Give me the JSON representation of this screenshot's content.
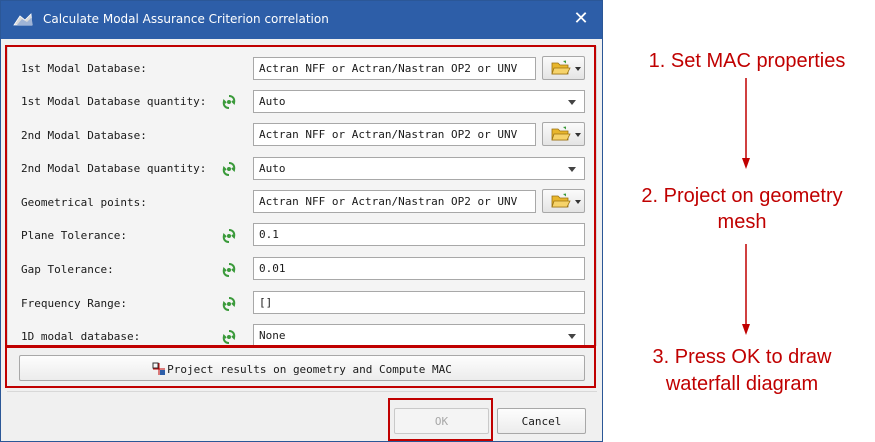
{
  "dialog": {
    "title": "Calculate Modal Assurance Criterion correlation",
    "close_glyph": "✕",
    "rows": [
      {
        "label": "1st Modal Database:",
        "type": "file",
        "value": "Actran NFF or Actran/Nastran OP2 or UNV"
      },
      {
        "label": "1st Modal Database quantity:",
        "type": "select",
        "value": "Auto"
      },
      {
        "label": "2nd Modal Database:",
        "type": "file",
        "value": "Actran NFF or Actran/Nastran OP2 or UNV"
      },
      {
        "label": "2nd Modal Database quantity:",
        "type": "select",
        "value": "Auto"
      },
      {
        "label": "Geometrical points:",
        "type": "file",
        "value": "Actran NFF or Actran/Nastran OP2 or UNV"
      },
      {
        "label": "Plane Tolerance:",
        "type": "text",
        "value": "0.1"
      },
      {
        "label": "Gap Tolerance:",
        "type": "text",
        "value": "0.01"
      },
      {
        "label": "Frequency Range:",
        "type": "text",
        "value": "[]"
      },
      {
        "label": "1D modal database:",
        "type": "select",
        "value": "None"
      }
    ],
    "project_button_label": "Project results on geometry and Compute MAC",
    "ok_label": "OK",
    "cancel_label": "Cancel"
  },
  "annotations": {
    "step1": "1. Set MAC properties",
    "step2_line1": "2. Project on geometry",
    "step2_line2": "mesh",
    "step3_line1": "3. Press OK to draw",
    "step3_line2": "waterfall diagram"
  },
  "colors": {
    "titlebar": "#2d5ea8",
    "annotation_red": "#c00000",
    "leaf_green": "#3a9a3a",
    "folder_yellow": "#e8b62c"
  },
  "icons": {
    "app": "app-logo-icon",
    "close": "close-icon",
    "browse": "folder-open-icon",
    "quantity": "refresh-leaf-icon",
    "project": "project-mesh-icon"
  }
}
